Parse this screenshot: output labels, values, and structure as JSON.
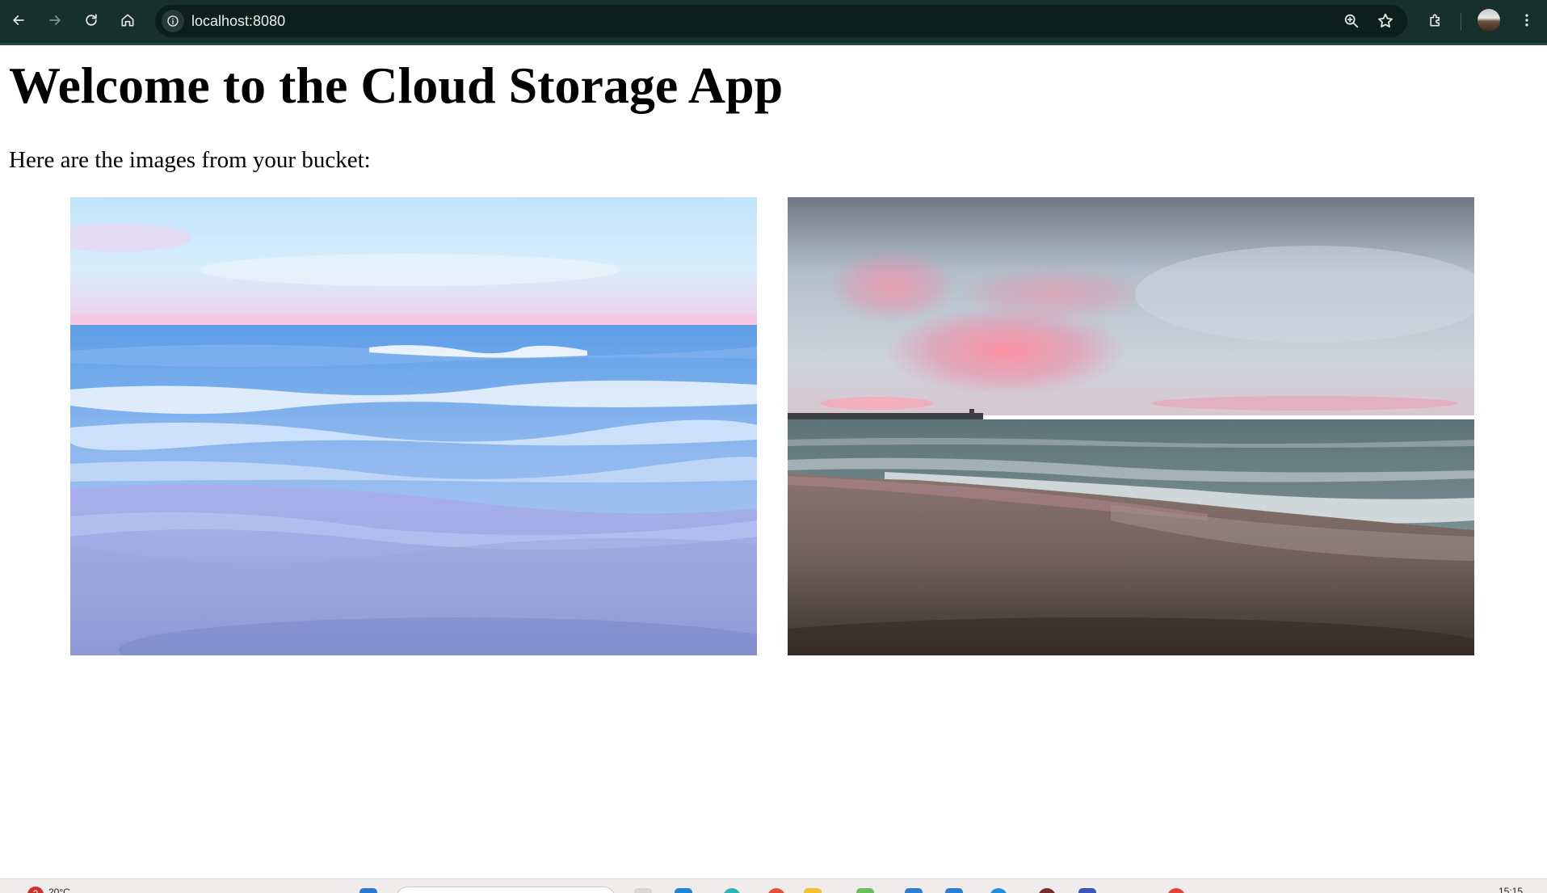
{
  "browser": {
    "url": "localhost:8080",
    "toolbar_icons": [
      "back-arrow-icon",
      "forward-arrow-icon",
      "reload-icon",
      "home-icon",
      "site-info-icon",
      "zoom-icon",
      "bookmark-star-icon",
      "extensions-icon",
      "profile-avatar",
      "more-menu-icon"
    ]
  },
  "page": {
    "title": "Welcome to the Cloud Storage App",
    "intro": "Here are the images from your bucket:",
    "images": [
      {
        "name": "bucket-image-1",
        "subject": "pastel blue ocean waves on a sandy beach"
      },
      {
        "name": "bucket-image-2",
        "subject": "beach at sunset with pink clouds and a pier"
      }
    ]
  },
  "taskbar": {
    "weather_badge": "2",
    "temperature": "20°C",
    "clock": "15:15"
  },
  "colors": {
    "chrome_bg": "#17302b",
    "omnibox_bg": "#0c1f1b",
    "page_bg": "#ffffff",
    "text": "#000000"
  }
}
